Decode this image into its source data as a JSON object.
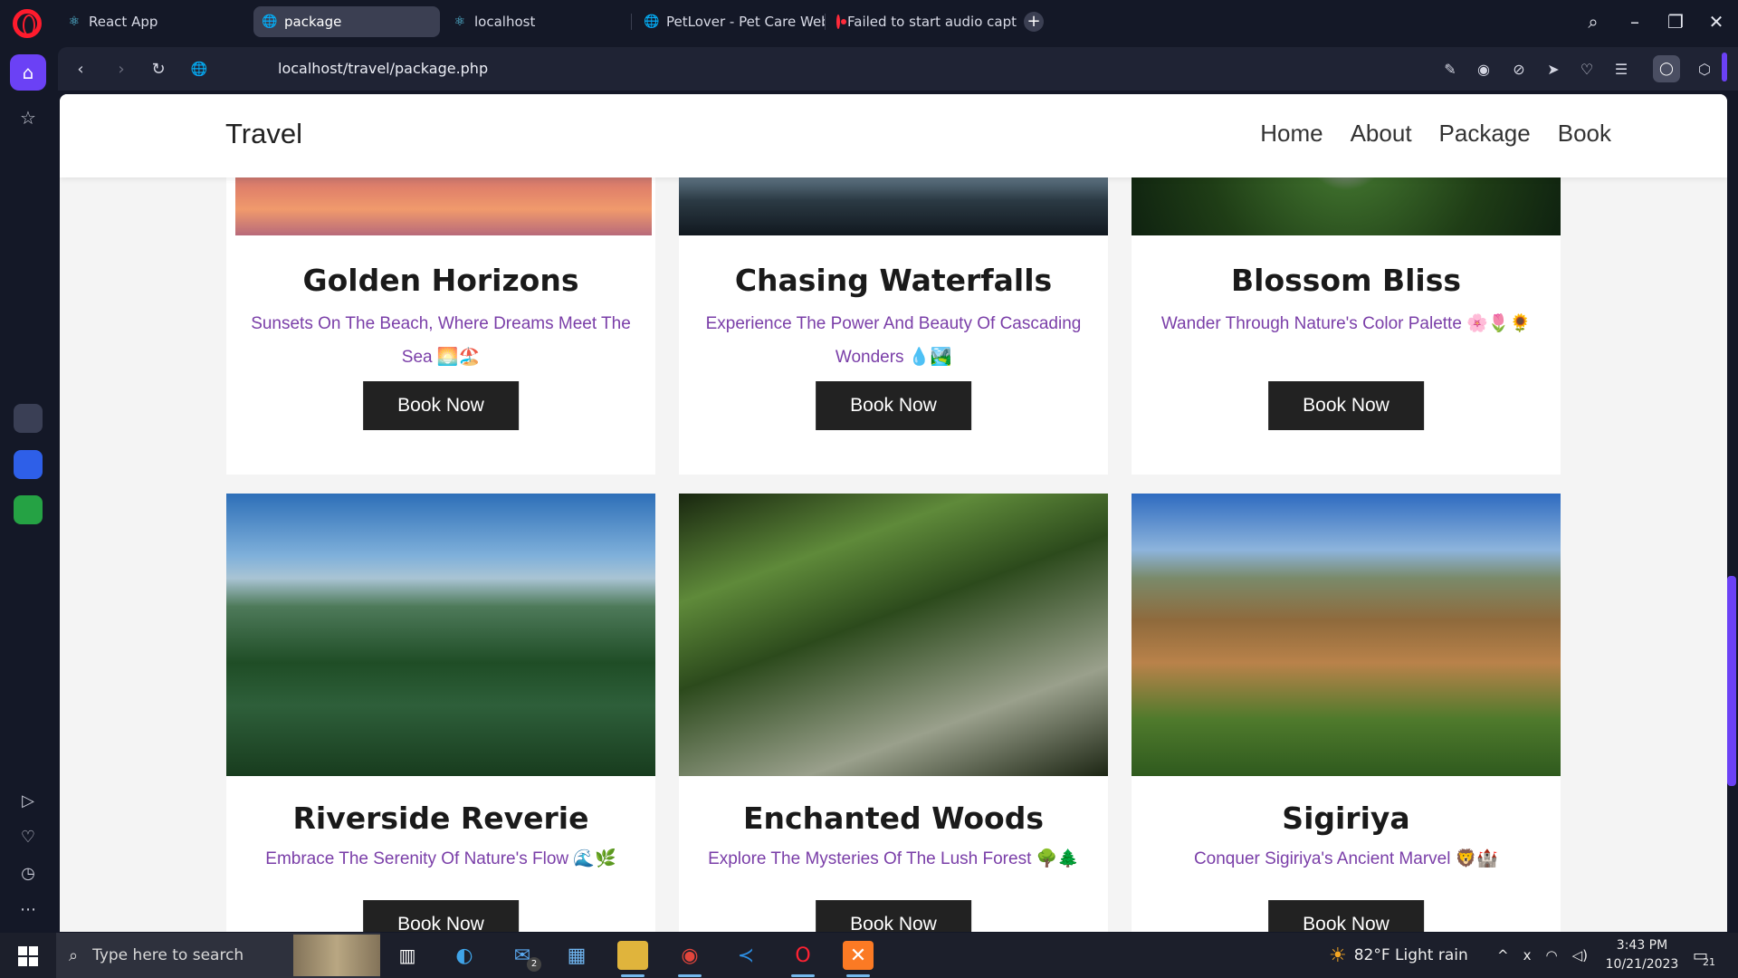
{
  "browser": {
    "tabs": [
      {
        "label": "React App",
        "icon": "react-icon",
        "active": false
      },
      {
        "label": "package",
        "icon": "globe-icon",
        "active": true
      },
      {
        "label": "localhost",
        "icon": "react-icon",
        "active": false
      },
      {
        "label": "PetLover - Pet Care Websi",
        "icon": "globe-icon",
        "active": false
      },
      {
        "label": "Failed to start audio captu",
        "icon": "record-icon",
        "active": false
      }
    ],
    "url": "localhost/travel/package.php"
  },
  "site": {
    "brand": "Travel",
    "nav": [
      "Home",
      "About",
      "Package",
      "Book"
    ]
  },
  "cards": [
    {
      "title": "Golden Horizons",
      "desc": "Sunsets On The Beach, Where Dreams Meet The Sea 🌅🏖️",
      "button": "Book Now"
    },
    {
      "title": "Chasing Waterfalls",
      "desc": "Experience The Power And Beauty Of Cascading Wonders 💧🏞️",
      "button": "Book Now"
    },
    {
      "title": "Blossom Bliss",
      "desc": "Wander Through Nature's Color Palette 🌸🌷🌻",
      "button": "Book Now"
    },
    {
      "title": "Riverside Reverie",
      "desc": "Embrace The Serenity Of Nature's Flow 🌊🌿",
      "button": "Book Now"
    },
    {
      "title": "Enchanted Woods",
      "desc": "Explore The Mysteries Of The Lush Forest 🌳🌲",
      "button": "Book Now"
    },
    {
      "title": "Sigiriya",
      "desc": "Conquer Sigiriya's Ancient Marvel 🦁🏰",
      "button": "Book Now"
    }
  ],
  "taskbar": {
    "search_placeholder": "Type here to search",
    "mail_badge": "2",
    "weather": "82°F  Light rain",
    "time": "3:43 PM",
    "date": "10/21/2023",
    "notification_count": "21"
  },
  "colors": {
    "accent": "#6b41f5",
    "card_desc": "#7a3ea8",
    "button_bg": "#222222"
  }
}
